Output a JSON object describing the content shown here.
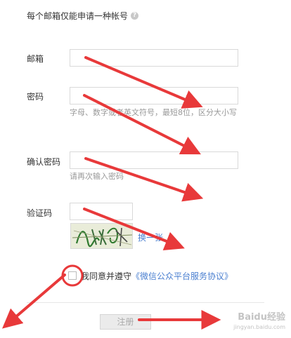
{
  "notice": {
    "text": "每个邮箱仅能申请一种帐号",
    "help_icon": "?"
  },
  "form": {
    "email": {
      "label": "邮箱",
      "value": ""
    },
    "password": {
      "label": "密码",
      "value": "",
      "hint": "字母、数字或者英文符号，最短8位，区分大小写"
    },
    "confirm_password": {
      "label": "确认密码",
      "value": "",
      "hint": "请再次输入密码"
    },
    "captcha": {
      "label": "验证码",
      "value": "",
      "refresh_link": "换一张"
    }
  },
  "agreement": {
    "checked": false,
    "prefix": "我同意并遵守",
    "link": "《微信公众平台服务协议》"
  },
  "submit": {
    "label": "注册"
  },
  "watermark": {
    "brand": "Baidu经验",
    "url": "jingyan.baidu.com"
  },
  "colors": {
    "annotation": "#e8393a",
    "link": "#4a7fd0",
    "label": "#333333",
    "hint": "#999999",
    "button_bg": "#ebebeb"
  }
}
